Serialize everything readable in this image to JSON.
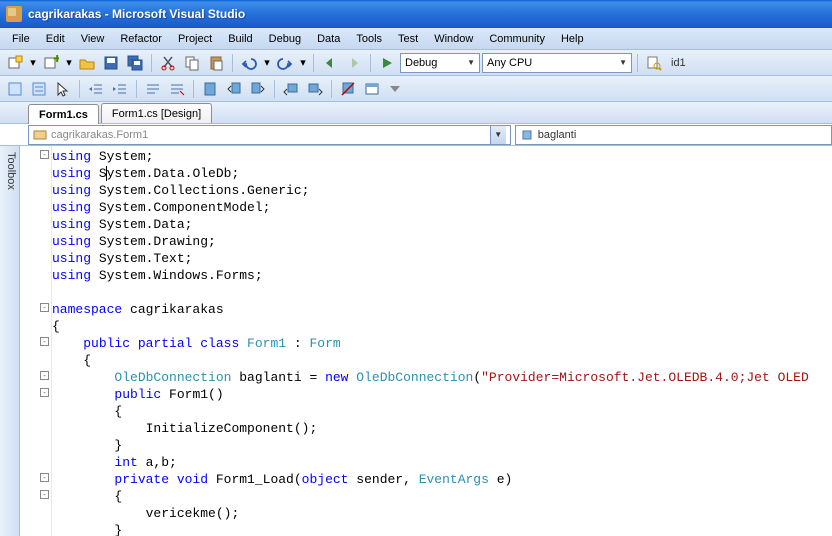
{
  "window": {
    "title": "cagrikarakas - Microsoft Visual Studio"
  },
  "menus": [
    "File",
    "Edit",
    "View",
    "Refactor",
    "Project",
    "Build",
    "Debug",
    "Data",
    "Tools",
    "Test",
    "Window",
    "Community",
    "Help"
  ],
  "toolbar": {
    "config": "Debug",
    "platform": "Any CPU",
    "find": "id1"
  },
  "tabs": [
    {
      "label": "Form1.cs",
      "active": true
    },
    {
      "label": "Form1.cs [Design]",
      "active": false
    }
  ],
  "nav": {
    "left": "cagrikarakas.Form1",
    "right": "baglanti"
  },
  "sidebar": {
    "toolbox": "Toolbox"
  },
  "code": {
    "usings": [
      [
        "using",
        " System;"
      ],
      [
        "using",
        " System.Data.OleDb;"
      ],
      [
        "using",
        " System.Collections.Generic;"
      ],
      [
        "using",
        " System.ComponentModel;"
      ],
      [
        "using",
        " System.Data;"
      ],
      [
        "using",
        " System.Drawing;"
      ],
      [
        "using",
        " System.Text;"
      ],
      [
        "using",
        " System.Windows.Forms;"
      ]
    ],
    "ns_kw": "namespace",
    "ns_name": " cagrikarakas",
    "brace_open": "{",
    "brace_close": "}",
    "class_line": {
      "public_partial_class": "public partial class",
      "name": " Form1 ",
      "colon": ": ",
      "base": "Form"
    },
    "conn_line": {
      "type": "OleDbConnection",
      "var": " baglanti = ",
      "newkw": "new",
      "ctor": " OleDbConnection",
      "paren": "(",
      "str": "\"Provider=Microsoft.Jet.OLEDB.4.0;Jet OLED",
      "close": ""
    },
    "ctor_line": {
      "publickw": "public",
      "rest": " Form1()"
    },
    "init_call": "InitializeComponent();",
    "int_line": {
      "intkw": "int",
      "vars": " a,b;"
    },
    "load_line": {
      "private_void": "private void",
      "name": " Form1_Load(",
      "objkw": "object",
      "sender": " sender, ",
      "argstype": "EventArgs",
      "e": " e)"
    },
    "veri_call": "vericekme();"
  }
}
